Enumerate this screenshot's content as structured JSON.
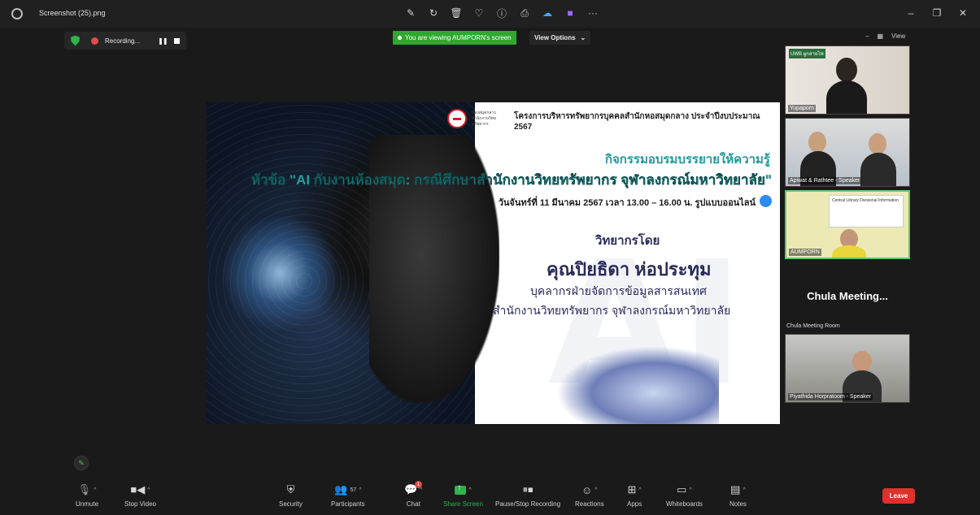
{
  "viewer": {
    "title": "Screenshot (25).png",
    "tool_icons": [
      "edit-icon",
      "rotate-icon",
      "delete-icon",
      "favorite-icon",
      "info-icon",
      "print-icon",
      "photos-cloud-icon",
      "clipchamp-icon",
      "more-icon"
    ],
    "window_controls": [
      "minimize-icon",
      "maximize-icon",
      "close-icon"
    ]
  },
  "zoom": {
    "recording_label": "Recording...",
    "viewing_banner": "You are viewing AUMPORN's screen",
    "view_options_label": "View Options",
    "view_button_label": "View",
    "colors": {
      "recording": "#e24a4a",
      "banner": "#2fa82f",
      "leave": "#d9342b",
      "shield": "#2fb34a"
    }
  },
  "shared_slide": {
    "logo_text": "ห้องสมุดกลาง สำนักงานวิทยทรัพยากร",
    "header": "โครงการบริหารทรัพยากรบุคคลสำนักหอสมุดกลาง ประจำปีงบประมาณ 2567",
    "activity": "กิจกรรมอบรมบรรยายให้ความรู้",
    "topic": "หัวข้อ \"AI กับงานห้องสมุด: กรณีศึกษาสำนักงานวิทยทรัพยากร จุฬาลงกรณ์มหาวิทยาลัย\"",
    "date": "วันจันทร์ที่ 11 มีนาคม 2567 เวลา 13.00 – 16.00 น. รูปแบบออนไลน์",
    "speaker_by": "วิทยากรโดย",
    "speaker_name": "คุณปิยธิดา ห่อประทุม",
    "speaker_role": "บุคลากรฝ่ายจัดการข้อมูลสารสนเทศ",
    "speaker_org": "สำนักงานวิทยทรัพยากร จุฬาลงกรณ์มหาวิทยาลัย",
    "watermark": "AI"
  },
  "participants_panel": {
    "tiles": [
      {
        "name": "Yupaporn",
        "badge": "UWB ผูกสายไฟ"
      },
      {
        "name": "Apiwat & Rathtee - Speaker"
      },
      {
        "name": "AUMPORN",
        "slide_text": "Central Library Divisional Information"
      },
      {
        "name": "Chula Meeting...",
        "room_label": "Chula Meeting Room"
      },
      {
        "name": "Piyathida Horpratoom - Speaker"
      }
    ]
  },
  "toolbar": {
    "unmute": "Unmute",
    "stop_video": "Stop Video",
    "security": "Security",
    "participants": "Participants",
    "participants_count": "57",
    "chat": "Chat",
    "chat_badge": "1",
    "share_screen": "Share Screen",
    "pause_stop_recording": "Pause/Stop Recording",
    "reactions": "Reactions",
    "apps": "Apps",
    "whiteboards": "Whiteboards",
    "notes": "Notes",
    "leave": "Leave"
  }
}
